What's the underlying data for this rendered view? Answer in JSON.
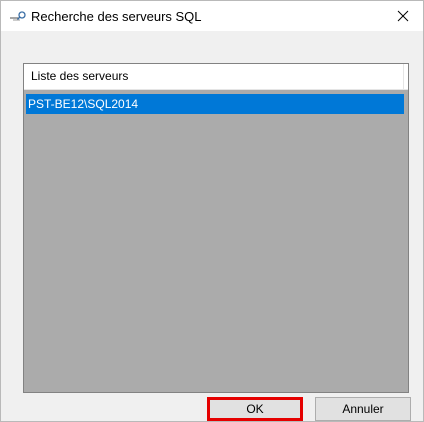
{
  "window": {
    "title": "Recherche des serveurs SQL",
    "icon": "app-search-icon",
    "close_icon": "close-icon"
  },
  "list": {
    "column_header": "Liste des serveurs",
    "items": [
      {
        "label": "PST-BE12\\SQL2014",
        "selected": true
      }
    ]
  },
  "buttons": {
    "ok_label": "OK",
    "cancel_label": "Annuler"
  },
  "colors": {
    "selection": "#0078d7",
    "list_background": "#ababab",
    "highlight_border": "#e50000"
  }
}
